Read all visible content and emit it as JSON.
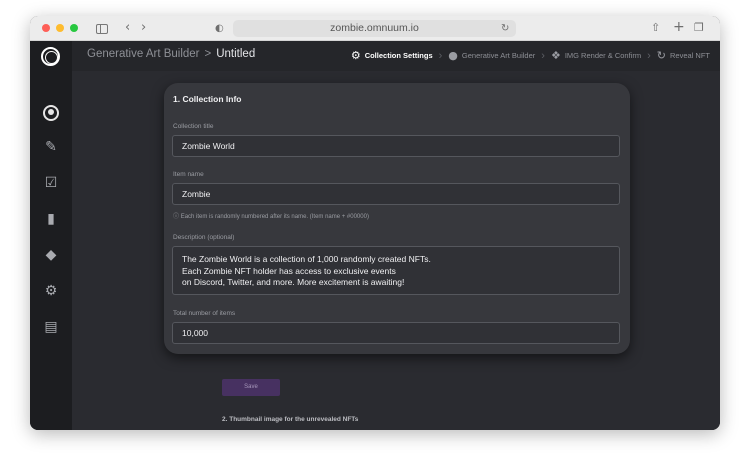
{
  "browser": {
    "url": "zombie.omnuum.io"
  },
  "header": {
    "breadcrumb_parent": "Generative Art Builder",
    "breadcrumb_separator": ">",
    "breadcrumb_current": "Untitled"
  },
  "steps": [
    {
      "label": "Collection Settings",
      "icon": "gear-icon",
      "active": true
    },
    {
      "label": "Generative Art Builder",
      "icon": "person-icon",
      "active": false
    },
    {
      "label": "IMG Render & Confirm",
      "icon": "render-icon",
      "active": false
    },
    {
      "label": "Reveal NFT",
      "icon": "refresh-icon",
      "active": false
    }
  ],
  "sidebar": {
    "items": [
      {
        "icon": "profile-icon"
      },
      {
        "icon": "edit-icon"
      },
      {
        "icon": "calendar-check-icon"
      },
      {
        "icon": "clipboard-icon"
      },
      {
        "icon": "ethereum-icon"
      },
      {
        "icon": "gear-icon"
      },
      {
        "icon": "book-icon"
      }
    ]
  },
  "form": {
    "section_title": "1. Collection Info",
    "collection_title_label": "Collection title",
    "collection_title_value": "Zombie World",
    "item_name_label": "Item name",
    "item_name_value": "Zombie",
    "item_name_hint": "Each item is randomly numbered after its name. (Item name + #00000)",
    "description_label": "Description (optional)",
    "description_line1": "The Zombie World is a collection of 1,000 randomly created NFTs.",
    "description_line2": "Each Zombie NFT holder has access to exclusive events",
    "description_line3": "on Discord, Twitter, and more. More excitement is awaiting!",
    "total_items_label": "Total number of items",
    "total_items_value": "10,000",
    "save_label": "Save"
  },
  "section2": {
    "title": "2. Thumbnail image for the unrevealed NFTs"
  },
  "colors": {
    "accent": "#473161",
    "background": "#2a2b30",
    "card": "#37383d"
  }
}
